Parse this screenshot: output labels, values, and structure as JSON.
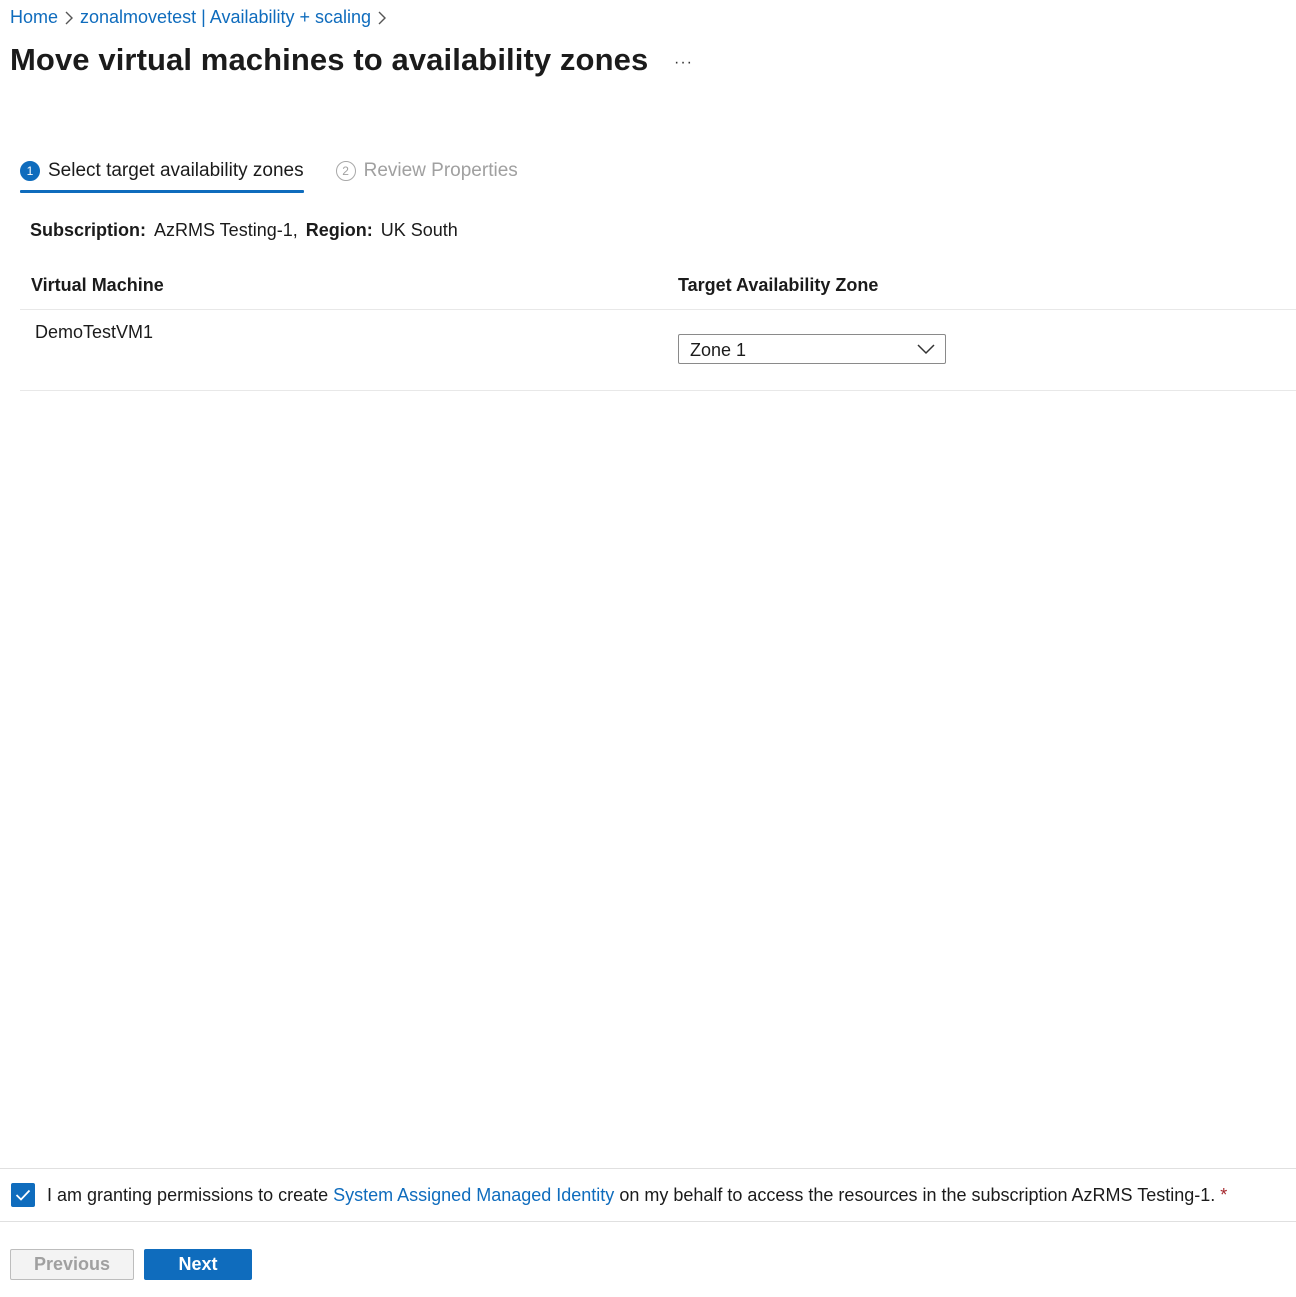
{
  "breadcrumb": {
    "items": [
      "Home",
      "zonalmovetest | Availability + scaling"
    ]
  },
  "header": {
    "title": "Move virtual machines to availability zones",
    "more_label": "···"
  },
  "steps": [
    {
      "number": "1",
      "label": "Select target availability zones",
      "active": true
    },
    {
      "number": "2",
      "label": "Review Properties",
      "active": false
    }
  ],
  "info": {
    "subscription_label": "Subscription:",
    "subscription_value": "AzRMS Testing-1,",
    "region_label": "Region:",
    "region_value": "UK South"
  },
  "table": {
    "columns": [
      "Virtual Machine",
      "Target Availability Zone"
    ],
    "rows": [
      {
        "vm": "DemoTestVM1",
        "zone": "Zone 1"
      }
    ]
  },
  "consent": {
    "checked": true,
    "text_before": "I am granting permissions to create ",
    "link_text": "System Assigned Managed Identity",
    "text_after": " on my behalf to access the resources in the subscription AzRMS Testing-1.",
    "required_marker": "*"
  },
  "buttons": {
    "previous_label": "Previous",
    "next_label": "Next"
  },
  "colors": {
    "accent": "#0f6cbd",
    "required": "#a4262c",
    "disabled_text": "#a0a0a0"
  }
}
